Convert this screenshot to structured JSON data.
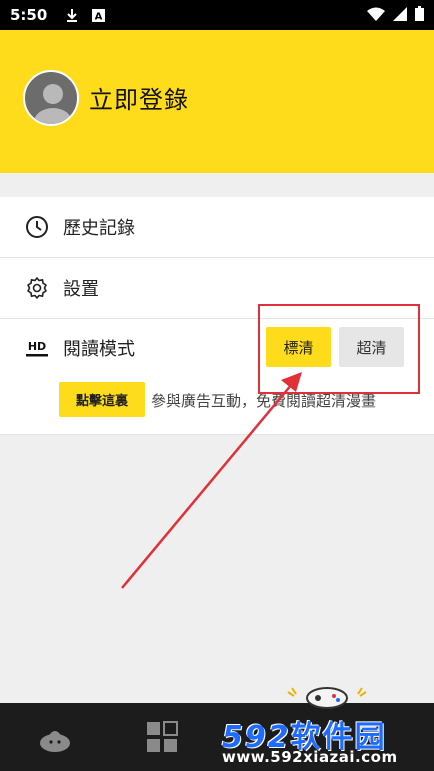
{
  "status_bar": {
    "time": "5:50",
    "icons": [
      "download-icon",
      "a-box-icon",
      "wifi-icon",
      "signal-icon",
      "battery-icon"
    ]
  },
  "profile": {
    "login_label": "立即登錄",
    "avatar_icon": "user-avatar-icon"
  },
  "menu": {
    "history": {
      "label": "歷史記錄",
      "icon": "clock-icon"
    },
    "settings": {
      "label": "設置",
      "icon": "gear-icon"
    },
    "reading_mode": {
      "label": "閱讀模式",
      "icon": "hd-icon",
      "icon_text": "HD",
      "options": [
        "標清",
        "超清"
      ],
      "selected": "標清"
    },
    "promo": {
      "button_label": "點擊這裏",
      "text": "參與廣告互動，免費閱讀超清漫畫"
    }
  },
  "bottom_nav": {
    "items": [
      "home-icon",
      "grid-icon"
    ]
  },
  "watermark": {
    "big_number": "592",
    "big_text": "软件园",
    "url": "www.592xiazai.com"
  },
  "colors": {
    "brand_yellow": "#fedc1c",
    "annotation_red": "#e0303a",
    "watermark_blue": "#1e6bff"
  }
}
